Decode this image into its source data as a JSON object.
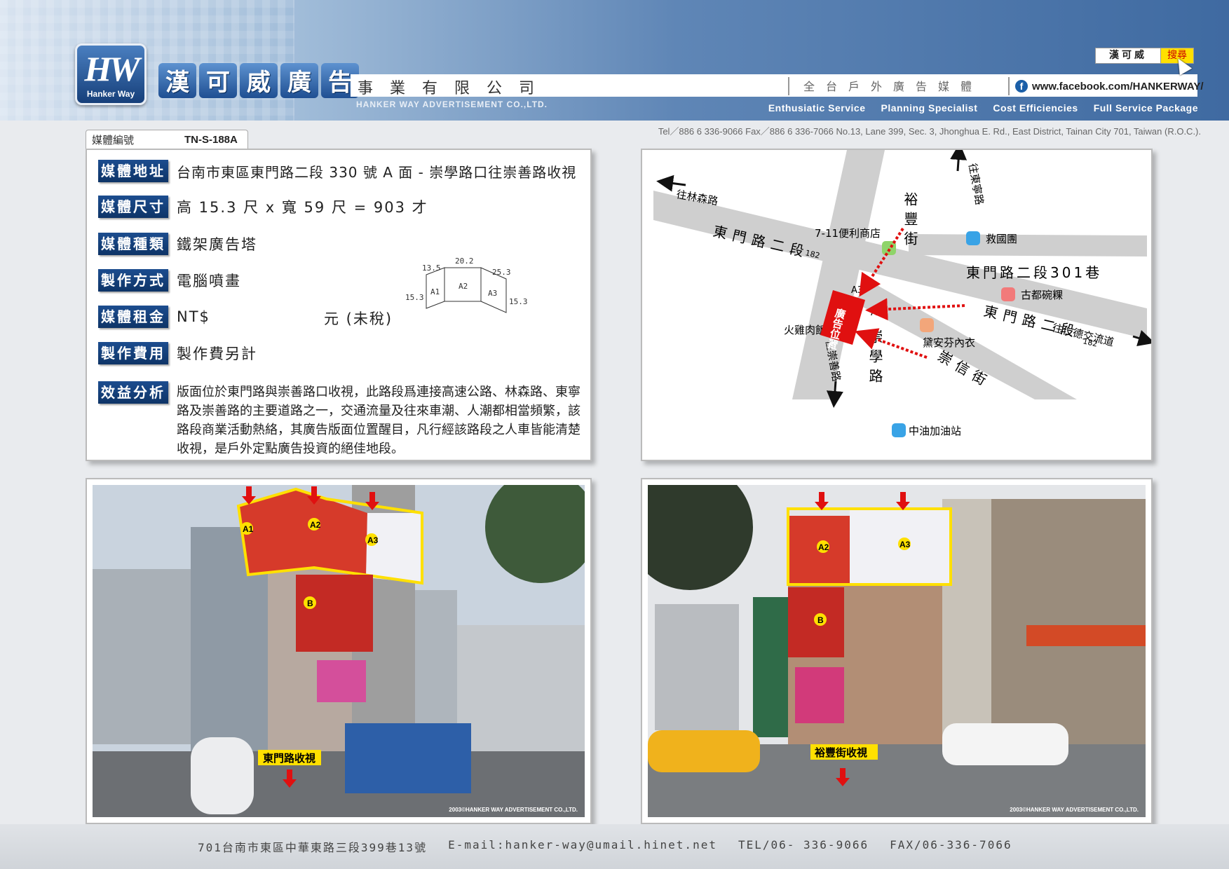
{
  "header": {
    "logo_text": "HW",
    "logo_sub": "Hanker Way",
    "brand_chars": [
      "漢",
      "可",
      "威",
      "廣",
      "告"
    ],
    "company_cn": "事業有限公司",
    "company_en": "HANKER WAY ADVERTISEMENT CO.,LTD.",
    "tagline_cn": "全台戶外廣告媒體",
    "facebook": "www.facebook.com/HANKERWAY/",
    "search_text": "漢可威",
    "search_button": "搜尋",
    "services": [
      "Enthusiatic Service",
      "Planning Specialist",
      "Cost Efficiencies",
      "Full Service Package"
    ],
    "contact": "Tel／886 6 336-9066   Fax／886 6 336-7066   No.13, Lane 399, Sec. 3, Jhonghua E. Rd., East District, Tainan City 701, Taiwan (R.O.C.)."
  },
  "media_code": {
    "label": "媒體編號",
    "value": "TN-S-188A"
  },
  "info": {
    "address": {
      "label": "媒體地址",
      "value": "台南市東區東門路二段 330 號 A 面 - 崇學路口往崇善路收視"
    },
    "size": {
      "label": "媒體尺寸",
      "value": "高 15.3 尺 x 寬 59 尺 = 903 才"
    },
    "type": {
      "label": "媒體種類",
      "value": "鐵架廣告塔"
    },
    "method": {
      "label": "製作方式",
      "value": "電腦噴畫"
    },
    "rent": {
      "label": "媒體租金",
      "value": "NT$",
      "suffix": "元 (未稅)"
    },
    "fee": {
      "label": "製作費用",
      "value": "製作費另計"
    },
    "analysis": {
      "label": "效益分析",
      "value": "版面位於東門路與崇善路口收視，此路段爲連接高速公路、林森路、東寧路及崇善路的主要道路之一，交通流量及往來車潮、人潮都相當頻繁，該路段商業活動熱絡，其廣告版面位置醒目，凡行經該路段之人車皆能清楚收視，是戶外定點廣告投資的絕佳地段。"
    },
    "dimensions": {
      "top": [
        "13.5",
        "20.2",
        "25.3"
      ],
      "height_left": "15.3",
      "height_right": "15.3",
      "panels": [
        "A1",
        "A2",
        "A3"
      ]
    }
  },
  "map": {
    "roads": {
      "dongmen_left": "東門路二段",
      "dongmen_left_no": "182",
      "dongmen_right": "東門路二段",
      "dongmen_right_no": "182",
      "lane": "東門路二段301巷",
      "yufeng": "裕豐街",
      "chongxue": "崇學路",
      "chongxin": "崇信街"
    },
    "directions": {
      "linsen": "往林森路",
      "dongning": "往東寧路",
      "chongshan": "往崇善路",
      "rende": "往仁德交流道"
    },
    "landmarks": {
      "seven": "7-11便利商店",
      "jiuguo": "救國團",
      "gudu": "古都碗粿",
      "huoji": "火雞肉飯",
      "daian": "黛安芬內衣",
      "cpc": "中油加油站"
    },
    "ad_label": "廣告位置",
    "marker_a2": "A2",
    "marker_a3": "A3"
  },
  "photos": {
    "left": {
      "caption": "東門路收視",
      "markers": [
        "A1",
        "A2",
        "A3",
        "B"
      ],
      "copyright": "2003©HANKER WAY ADVERTISEMENT CO.,LTD."
    },
    "right": {
      "caption": "裕豐街收視",
      "markers": [
        "A2",
        "A3",
        "B"
      ],
      "copyright": "2003©HANKER WAY ADVERTISEMENT CO.,LTD."
    }
  },
  "footer": {
    "address": "701台南市東區中華東路三段399巷13號",
    "email": "E-mail:hanker-way@umail.hinet.net",
    "tel": "TEL/06- 336-9066",
    "fax": "FAX/06-336-7066"
  },
  "colors": {
    "brand_blue": "#0e3467",
    "marker_yellow": "#ffe000",
    "arrow_red": "#e01010"
  }
}
